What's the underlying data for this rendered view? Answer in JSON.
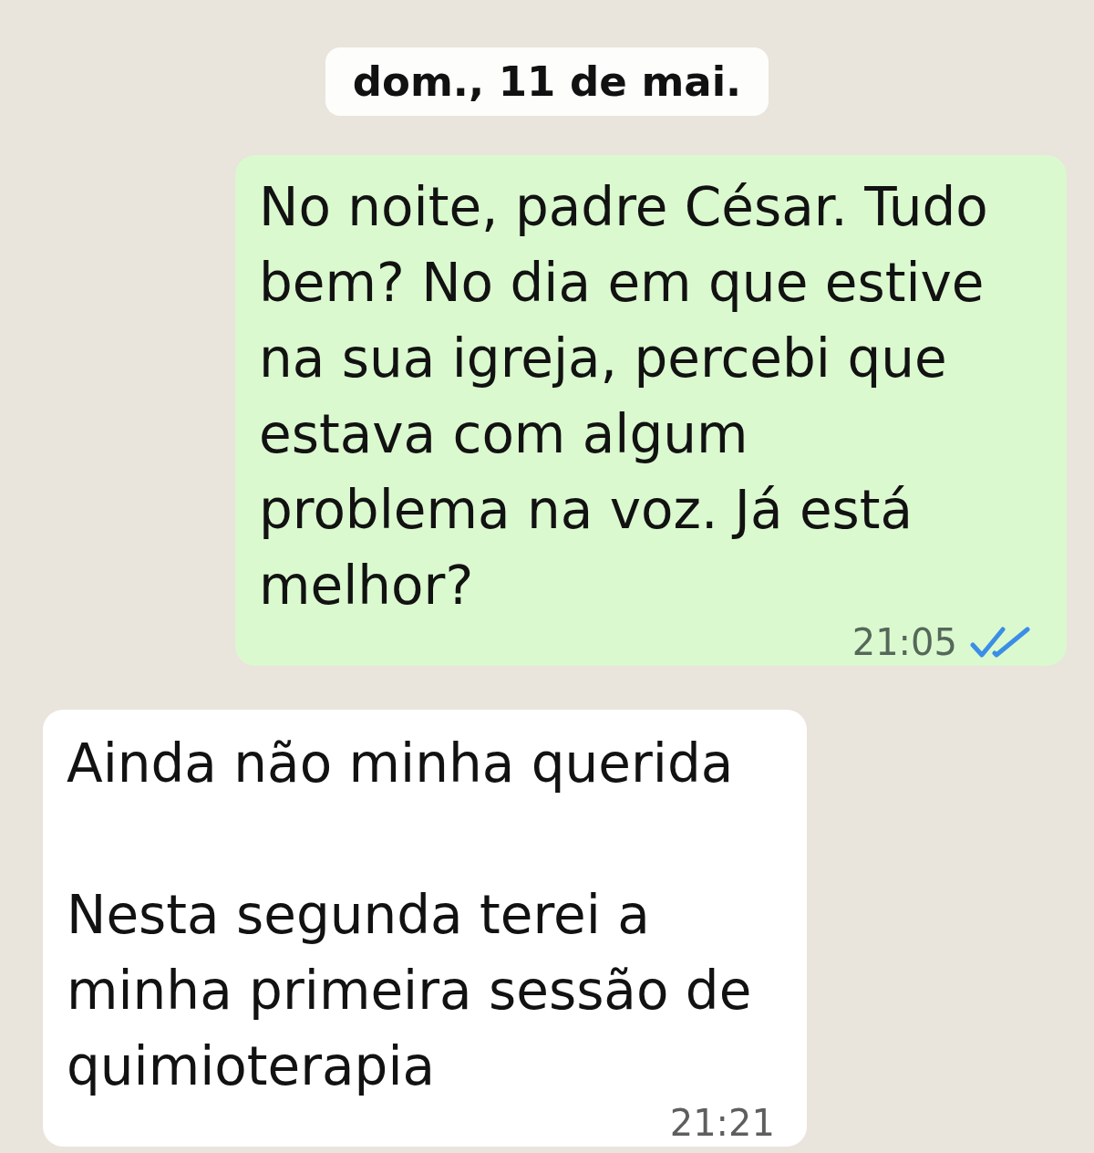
{
  "date_separator": {
    "label": "dom., 11 de mai."
  },
  "messages": [
    {
      "kind": "outgoing",
      "text": "No noite, padre César. Tudo bem? No dia em que estive na sua igreja, percebi que estava com algum problema na voz. Já está melhor?",
      "time": "21:05",
      "read": true
    },
    {
      "kind": "incoming",
      "text": "Ainda não minha querida\n\nNesta segunda terei a minha primeira sessão de quimioterapia",
      "time": "21:21"
    }
  ]
}
